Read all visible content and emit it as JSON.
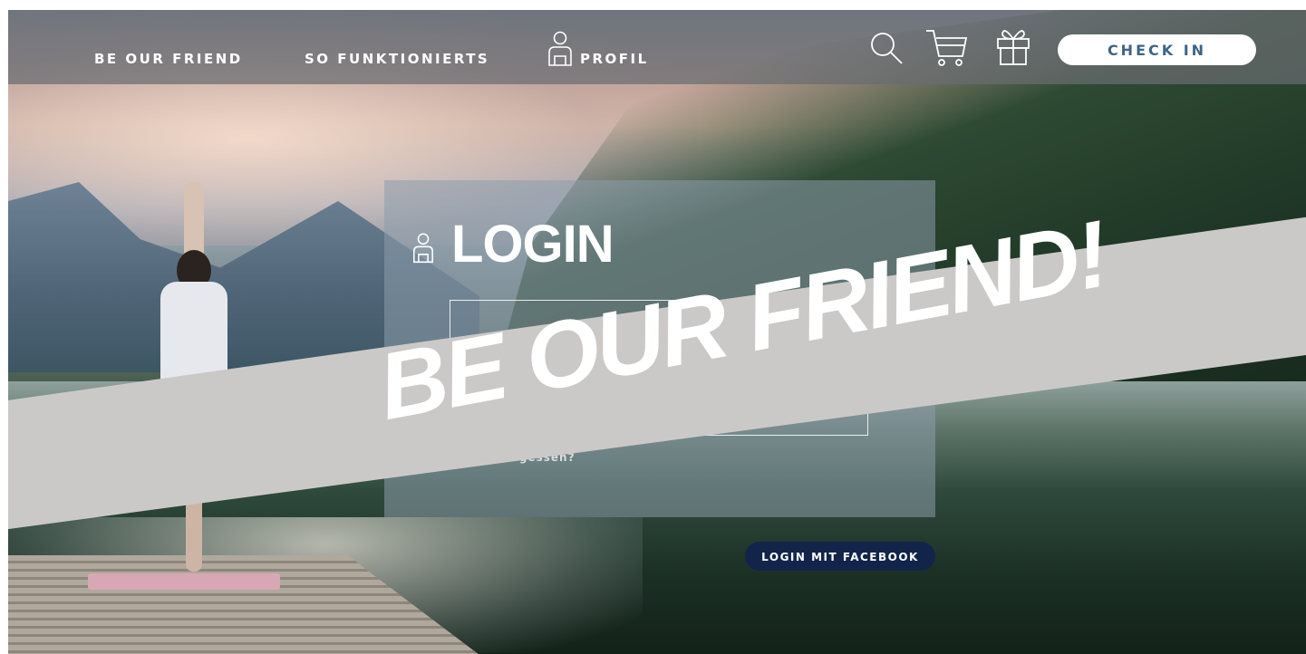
{
  "nav": {
    "items": [
      {
        "label": "BE OUR FRIEND"
      },
      {
        "label": "SO FUNKTIONIERTS"
      },
      {
        "label": "PROFIL",
        "icon": "user-icon"
      }
    ],
    "icons": [
      "search-icon",
      "cart-icon",
      "gift-icon"
    ],
    "checkin_label": "CHECK IN"
  },
  "login": {
    "title": "LOGIN",
    "icon": "user-icon",
    "forgot_label": "vergessen?",
    "facebook_label": "LOGIN MIT FACEBOOK"
  },
  "banner": {
    "text": "BE OUR FRIEND!"
  },
  "colors": {
    "accent_text": "#3e6585",
    "facebook_button": "#13244a",
    "banner": "#cbc9c7"
  }
}
